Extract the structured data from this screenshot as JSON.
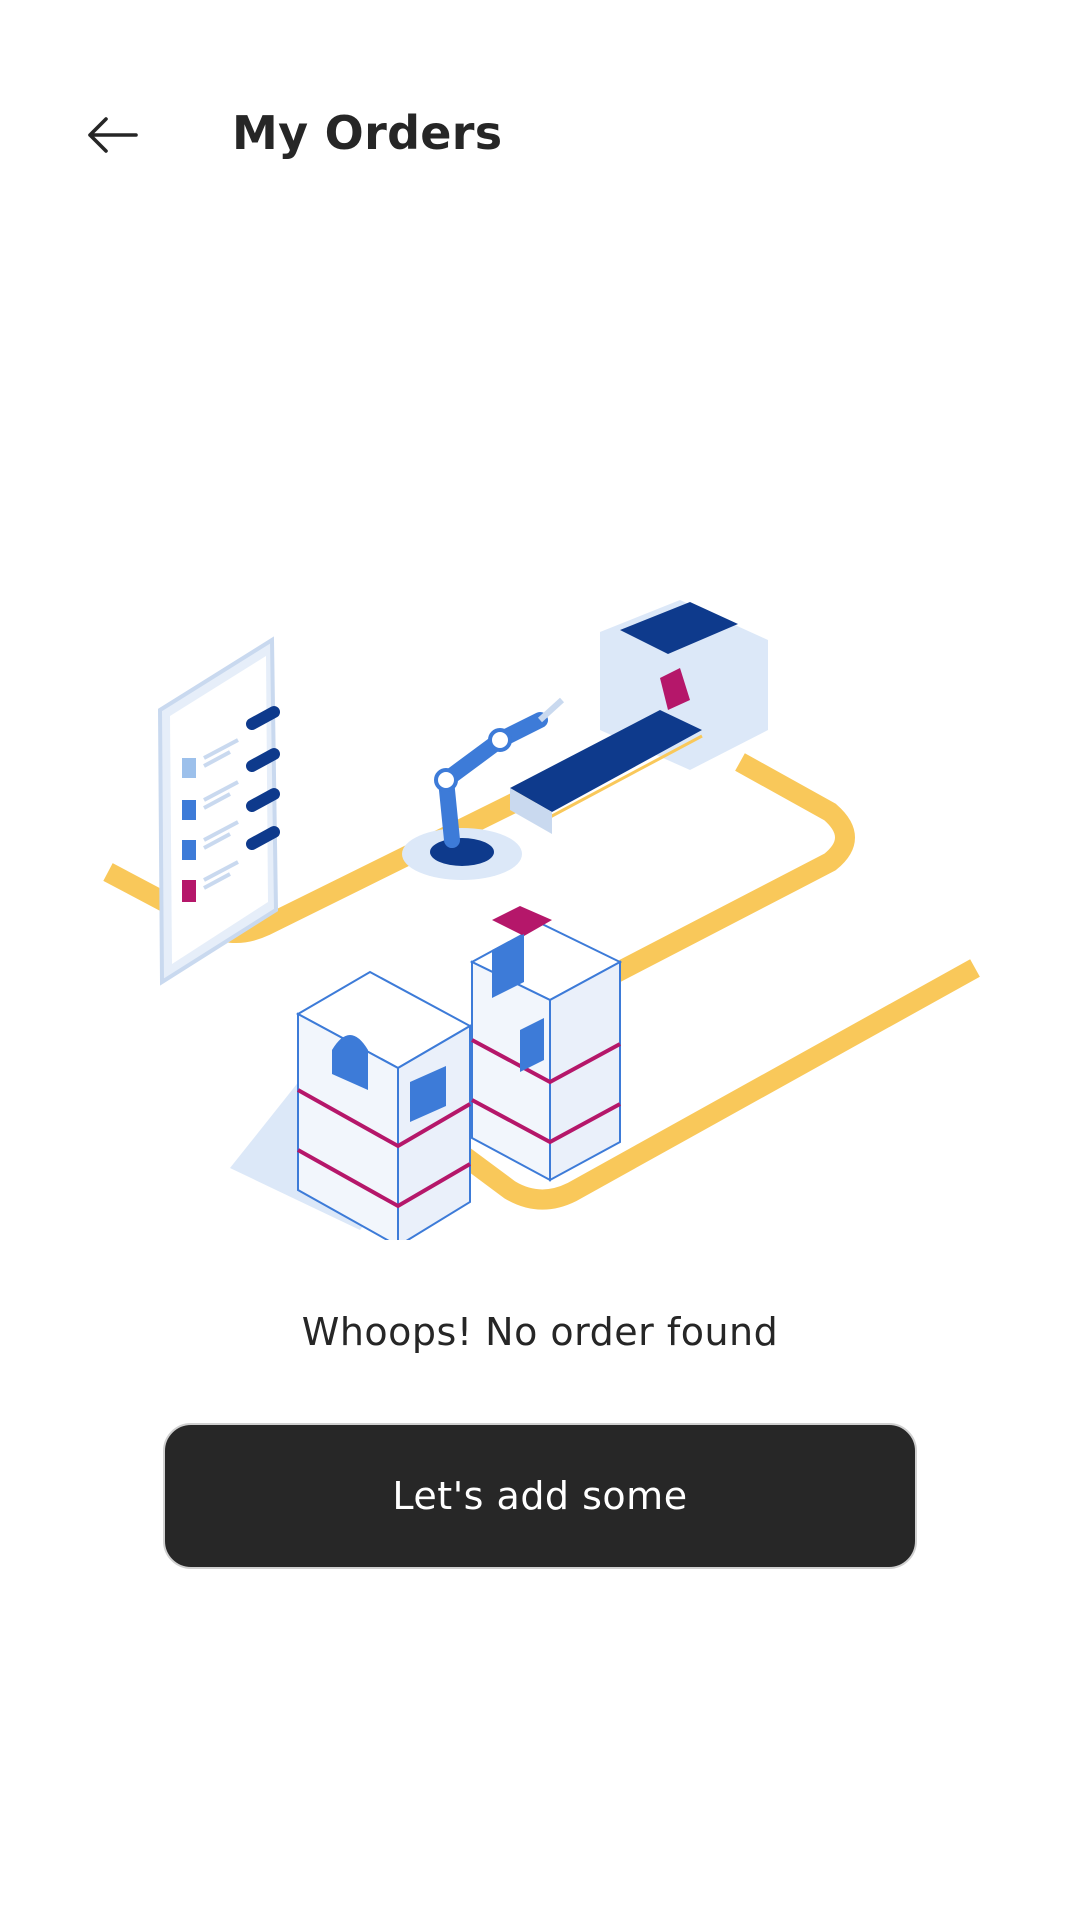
{
  "header": {
    "back_icon": "arrow-left-icon",
    "title": "My Orders"
  },
  "empty_state": {
    "illustration": "warehouse-conveyor-illustration",
    "message": "Whoops! No order found",
    "button_label": "Let's add some"
  },
  "colors": {
    "text_primary": "#262626",
    "button_background": "#272727",
    "button_text": "#ffffff",
    "accent_yellow": "#F9C85A",
    "accent_navy": "#0E3A8C",
    "accent_blue": "#3D7BD8",
    "accent_magenta": "#B5176A",
    "light_blue": "#DCE8F8"
  }
}
